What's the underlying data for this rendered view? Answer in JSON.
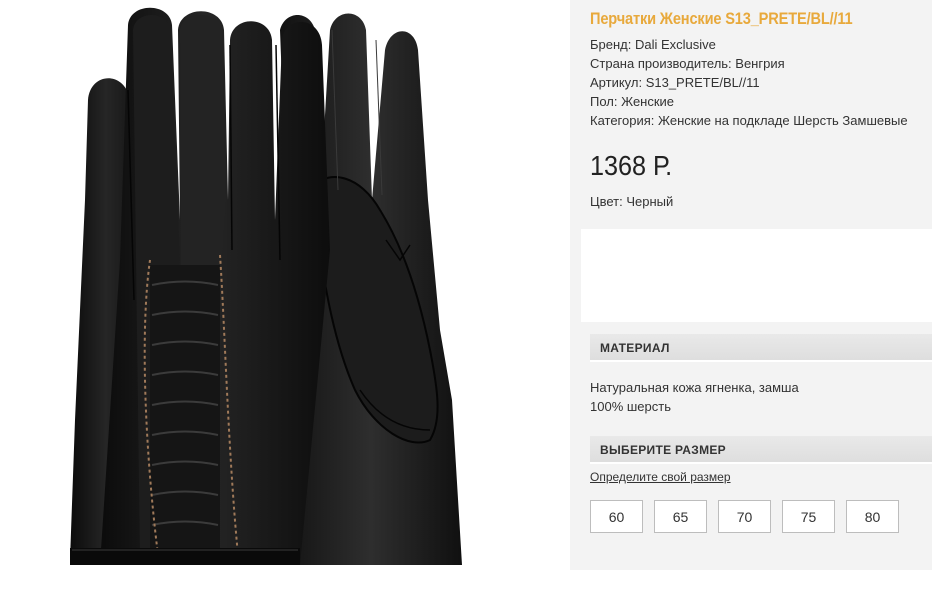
{
  "product": {
    "title": "Перчатки Женские S13_PRETE/BL//11",
    "specs": [
      "Бренд: Dali Exclusive",
      "Страна производитель: Венгрия",
      "Артикул: S13_PRETE/BL//11",
      "Пол: Женские",
      "Категория: Женские на подкладе Шерсть Замшевые"
    ],
    "price": "1368 Р.",
    "color": "Цвет: Черный",
    "image_icon": "glove-product-photo"
  },
  "material": {
    "heading": "МАТЕРИАЛ",
    "lines": [
      "Натуральная кожа ягненка, замша",
      "100% шерсть"
    ]
  },
  "size": {
    "heading": "ВЫБЕРИТЕ РАЗМЕР",
    "link": "Определите свой размер",
    "options": [
      "60",
      "65",
      "70",
      "75",
      "80"
    ]
  },
  "colors": {
    "title": "#e8a93c",
    "panel": "#f3f3f3",
    "section_header": "#e4e4e4",
    "leather": "#141414"
  }
}
